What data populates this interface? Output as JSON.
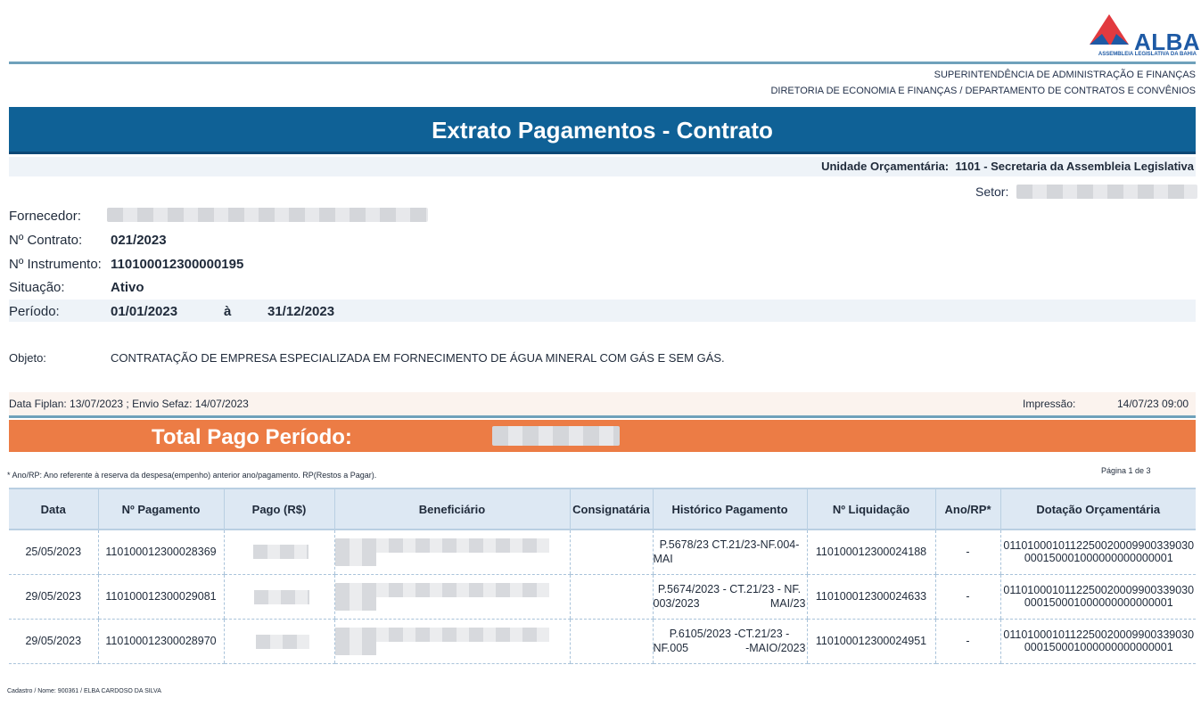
{
  "logo": {
    "name": "ALBA",
    "subtitle": "ASSEMBLEIA LEGISLATIVA DA BAHIA",
    "colors": {
      "red": "#e23a3f",
      "blue": "#1e5aa5"
    }
  },
  "header": {
    "dept_line1": "SUPERINTENDÊNCIA DE ADMINISTRAÇÃO E FINANÇAS",
    "dept_line2": "DIRETORIA DE ECONOMIA E FINANÇAS / DEPARTAMENTO DE CONTRATOS E CONVÊNIOS",
    "title": "Extrato Pagamentos - Contrato",
    "unidade_label": "Unidade Orçamentária:",
    "unidade_value": "1101 - Secretaria da Assembleia Legislativa",
    "setor_label": "Setor:"
  },
  "contract": {
    "fornecedor_label": "Fornecedor:",
    "contrato_label": "Nº Contrato:",
    "contrato_value": "021/2023",
    "instrumento_label": "Nº Instrumento:",
    "instrumento_value": "110100012300000195",
    "situacao_label": "Situação:",
    "situacao_value": "Ativo",
    "periodo_label": "Período:",
    "periodo_start": "01/01/2023",
    "periodo_sep": "à",
    "periodo_end": "31/12/2023",
    "objeto_label": "Objeto:",
    "objeto_value": "CONTRATAÇÃO DE EMPRESA ESPECIALIZADA EM FORNECIMENTO DE ÁGUA MINERAL COM GÁS E SEM GÁS."
  },
  "dates": {
    "fiplan_text": "Data Fiplan:  13/07/2023 ; Envio Sefaz:  14/07/2023",
    "impressao_label": "Impressão:",
    "impressao_value": "14/07/23 09:00"
  },
  "total": {
    "label": "Total Pago Período:"
  },
  "footnote": "* Ano/RP: Ano referente à reserva da despesa(empenho) anterior ano/pagamento. RP(Restos a Pagar).",
  "pagination": "Página  1  de  3",
  "table": {
    "headers": [
      "Data",
      "Nº Pagamento",
      "Pago (R$)",
      "Beneficiário",
      "Consignatária",
      "Histórico Pagamento",
      "Nº Liquidação",
      "Ano/RP*",
      "Dotação Orçamentária"
    ],
    "rows": [
      {
        "data": "25/05/2023",
        "pagamento": "110100012300028369",
        "historico": "P.5678/23 CT.21/23-NF.004-MAI",
        "liquidacao": "110100012300024188",
        "ano_rp": "-",
        "dotacao": "0110100010112250020009900339030000150001000000000000001"
      },
      {
        "data": "29/05/2023",
        "pagamento": "110100012300029081",
        "historico": "P.5674/2023 - CT.21/23 - NF. 003/2023 MAI/23",
        "liquidacao": "110100012300024633",
        "ano_rp": "-",
        "dotacao": "0110100010112250020009900339030000150001000000000000001"
      },
      {
        "data": "29/05/2023",
        "pagamento": "110100012300028970",
        "historico": "P.6105/2023 -CT.21/23 - NF.005 -MAIO/2023",
        "liquidacao": "110100012300024951",
        "ano_rp": "-",
        "dotacao": "0110100010112250020009900339030000150001000000000000001"
      }
    ]
  },
  "cadastro": "Cadastro / Nome:  900361 / ELBA CARDOSO DA SILVA"
}
